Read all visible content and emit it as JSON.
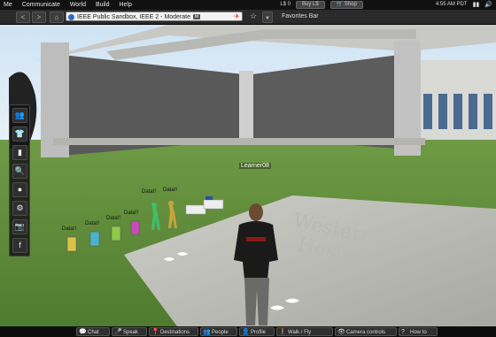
{
  "menubar": {
    "items": [
      "Me",
      "Communicate",
      "World",
      "Build",
      "Help"
    ],
    "balance": "L$ 0",
    "buy_label": "Buy L$",
    "shop_label": "Shop",
    "clock": "4:55 AM PDT"
  },
  "navbar": {
    "back_glyph": "<",
    "forward_glyph": ">",
    "home_glyph": "⌂",
    "location": "IEEE Public Sandbox, IEEE 2 - Moderate",
    "maturity_badge": "M",
    "favorites_label": "Favorites Bar"
  },
  "sidebar": {
    "buttons": [
      {
        "name": "people",
        "glyph": "👥"
      },
      {
        "name": "appearance",
        "glyph": "👕"
      },
      {
        "name": "inventory",
        "glyph": "▮"
      },
      {
        "name": "search",
        "glyph": "🔍"
      },
      {
        "name": "places",
        "glyph": "●"
      },
      {
        "name": "settings",
        "glyph": "⚙"
      },
      {
        "name": "snapshot",
        "glyph": "📷"
      },
      {
        "name": "facebook",
        "glyph": "f"
      }
    ]
  },
  "scene": {
    "avatar_name": "Learner08",
    "sign_text": "Western Hospital",
    "data_labels": [
      "Data!!",
      "Data!!",
      "Data!!",
      "Data!!",
      "Data!!",
      "Data!!"
    ]
  },
  "bottombar": {
    "chat": "Chat",
    "speak": "Speak",
    "destinations": "Destinations",
    "people": "People",
    "profile": "Profile",
    "walk_fly": "Walk / Fly",
    "camera": "Camera controls",
    "howto": "How to"
  },
  "colors": {
    "grass": "#5e8a3a",
    "wall": "#5a5a5a",
    "pillar": "#bdbdbd"
  }
}
